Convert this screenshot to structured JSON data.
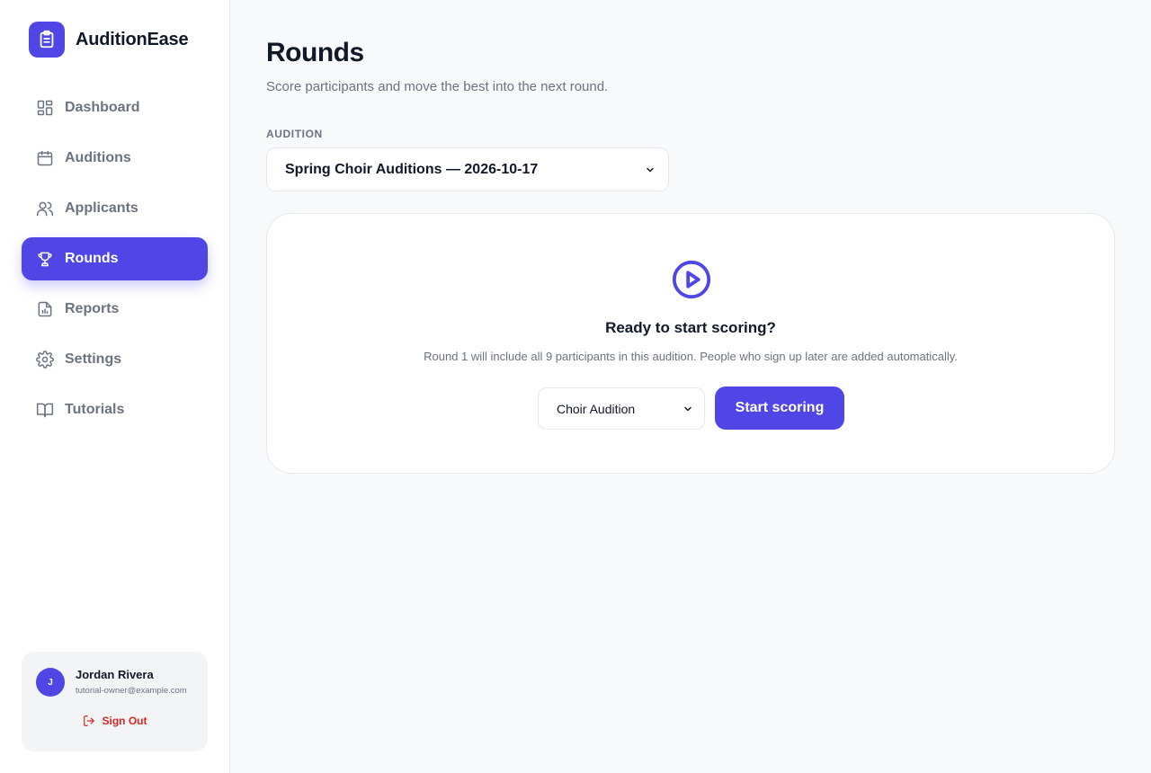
{
  "app": {
    "name": "AuditionEase",
    "logo_icon": "clipboard-icon",
    "accent": "#4f46e5"
  },
  "sidebar": {
    "items": [
      {
        "label": "Dashboard",
        "icon": "dashboard-icon"
      },
      {
        "label": "Auditions",
        "icon": "calendar-icon"
      },
      {
        "label": "Applicants",
        "icon": "users-icon"
      },
      {
        "label": "Rounds",
        "icon": "trophy-icon",
        "active": true
      },
      {
        "label": "Reports",
        "icon": "report-icon"
      },
      {
        "label": "Settings",
        "icon": "gear-icon"
      },
      {
        "label": "Tutorials",
        "icon": "book-icon"
      }
    ]
  },
  "user": {
    "initial": "J",
    "name": "Jordan Rivera",
    "email": "tutorial-owner@example.com",
    "sign_out": "Sign Out"
  },
  "page": {
    "title": "Rounds",
    "subtitle": "Score participants and move the best into the next round."
  },
  "audition": {
    "label": "AUDITION",
    "selected": "Spring Choir Auditions — 2026-10-17"
  },
  "start_card": {
    "title": "Ready to start scoring?",
    "text": "Round 1 will include all 9 participants in this audition. People who sign up later are added automatically.",
    "template_selected": "Choir Audition",
    "button": "Start scoring"
  }
}
